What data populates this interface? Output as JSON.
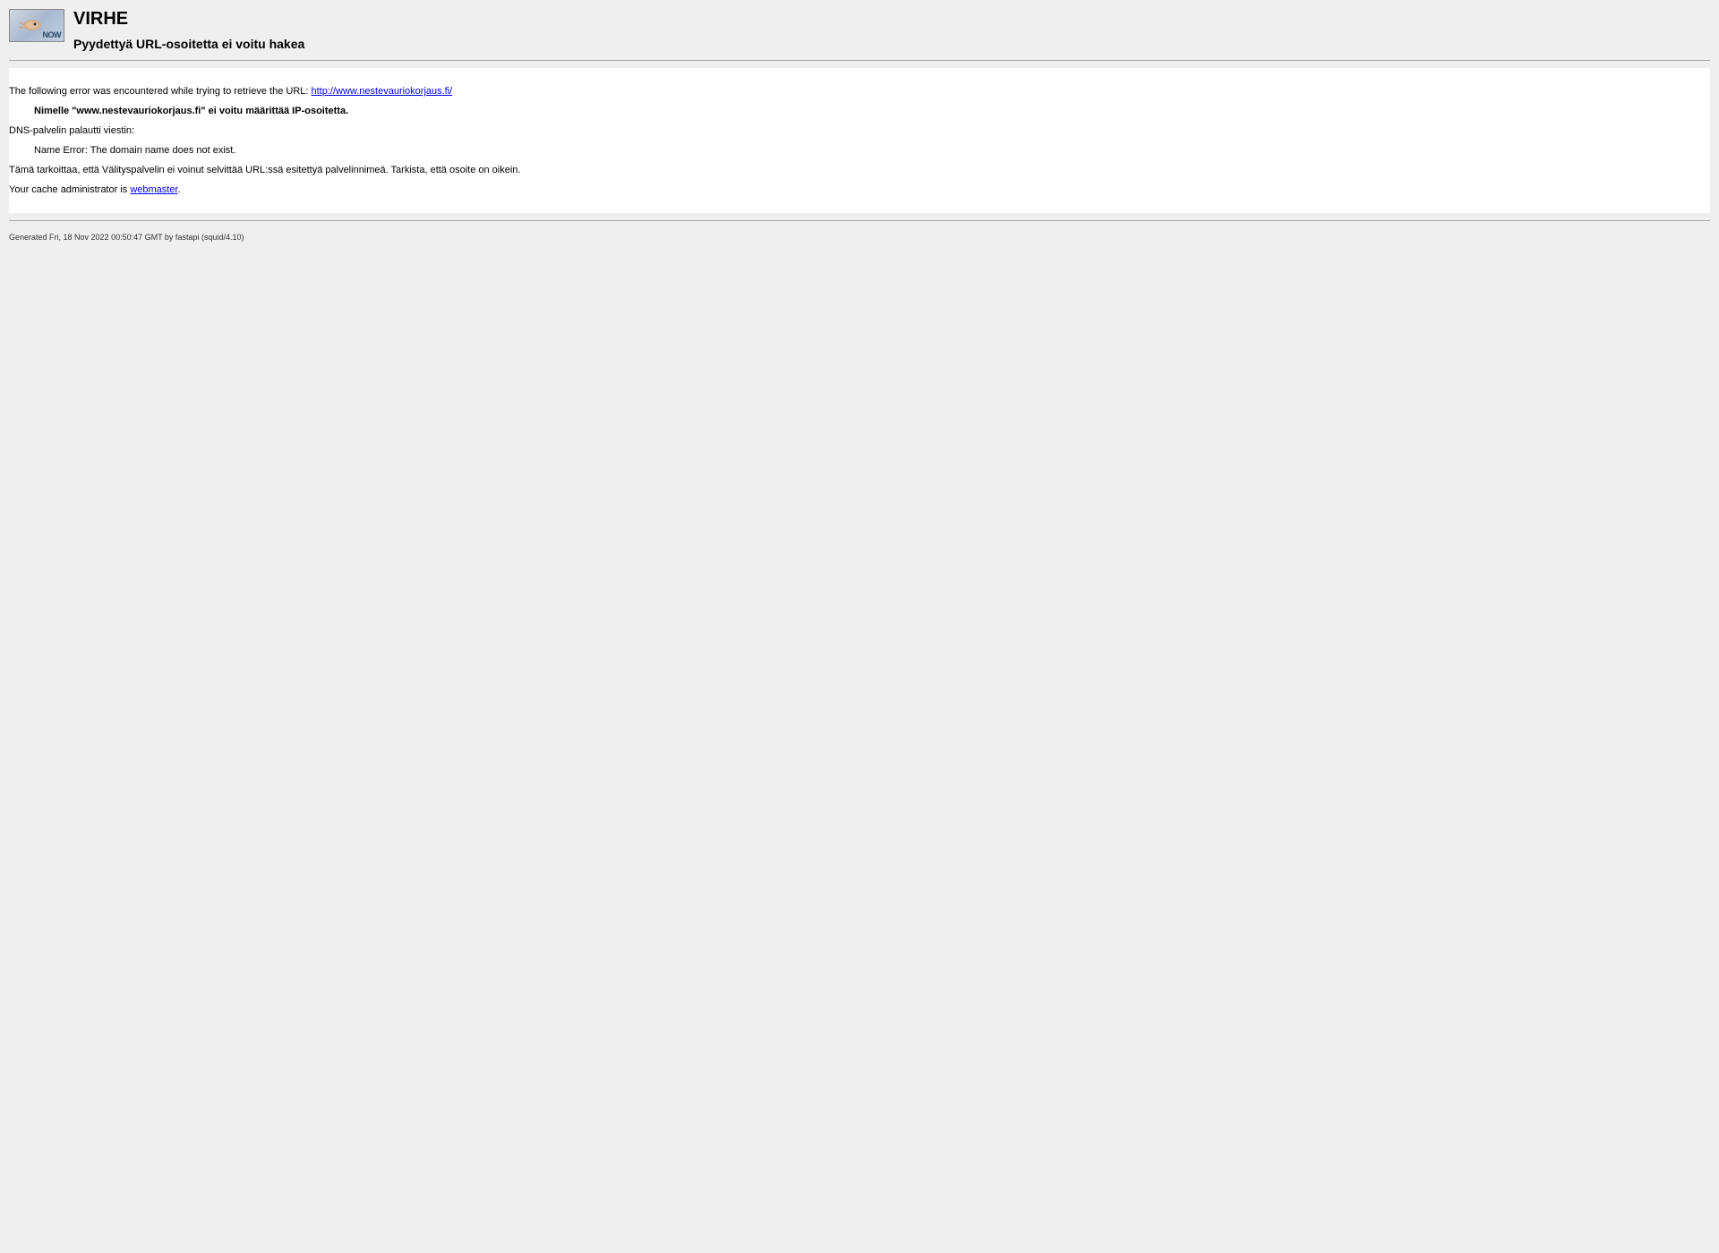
{
  "header": {
    "icon_label": "NOW",
    "title": "VIRHE",
    "subtitle": "Pyydettyä URL-osoitetta ei voitu hakea"
  },
  "body": {
    "intro_text": "The following error was encountered while trying to retrieve the URL: ",
    "url_link": "http://www.nestevauriokorjaus.fi/",
    "error_bold": "Nimelle \"www.nestevauriokorjaus.fi\" ei voitu määrittää IP-osoitetta.",
    "dns_message_label": "DNS-palvelin palautti viestin:",
    "dns_error": "Name Error: The domain name does not exist.",
    "explanation": "Tämä tarkoittaa, että Välityspalvelin ei voinut selvittää URL:ssä esitettyä palvelinnimeä. Tarkista, että osoite on oikein.",
    "admin_text": "Your cache administrator is ",
    "admin_link": "webmaster",
    "admin_suffix": "."
  },
  "footer": {
    "generated": "Generated Fri, 18 Nov 2022 00:50:47 GMT by fastapi (squid/4.10)"
  }
}
